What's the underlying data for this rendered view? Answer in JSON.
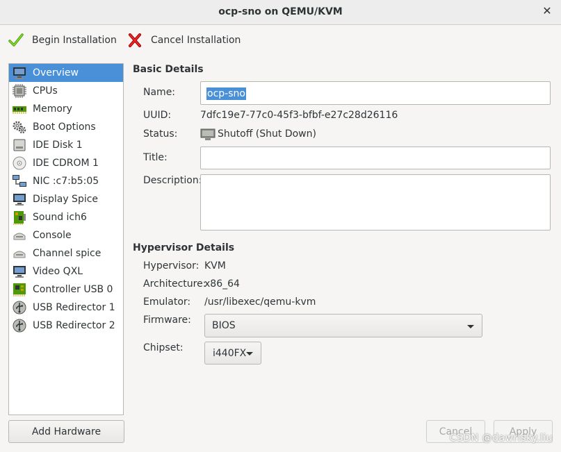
{
  "window": {
    "title": "ocp-sno on QEMU/KVM"
  },
  "toolbar": {
    "begin_label": "Begin Installation",
    "cancel_label": "Cancel Installation"
  },
  "sidebar": {
    "items": [
      {
        "label": "Overview",
        "icon": "monitor-icon",
        "selected": true
      },
      {
        "label": "CPUs",
        "icon": "cpu-icon"
      },
      {
        "label": "Memory",
        "icon": "memory-icon"
      },
      {
        "label": "Boot Options",
        "icon": "gears-icon"
      },
      {
        "label": "IDE Disk 1",
        "icon": "disk-icon"
      },
      {
        "label": "IDE CDROM 1",
        "icon": "cdrom-icon"
      },
      {
        "label": "NIC :c7:b5:05",
        "icon": "network-icon"
      },
      {
        "label": "Display Spice",
        "icon": "display-icon"
      },
      {
        "label": "Sound ich6",
        "icon": "sound-icon"
      },
      {
        "label": "Console",
        "icon": "console-icon"
      },
      {
        "label": "Channel spice",
        "icon": "channel-icon"
      },
      {
        "label": "Video QXL",
        "icon": "video-icon"
      },
      {
        "label": "Controller USB 0",
        "icon": "controller-icon"
      },
      {
        "label": "USB Redirector 1",
        "icon": "usb-icon"
      },
      {
        "label": "USB Redirector 2",
        "icon": "usb-icon"
      }
    ],
    "add_hardware_label": "Add Hardware"
  },
  "basic": {
    "section_title": "Basic Details",
    "name_label": "Name:",
    "name_value": "ocp-sno",
    "uuid_label": "UUID:",
    "uuid_value": "7dfc19e7-77c0-45f3-bfbf-e27c28d26116",
    "status_label": "Status:",
    "status_value": "Shutoff (Shut Down)",
    "title_label": "Title:",
    "title_value": "",
    "description_label": "Description:",
    "description_value": ""
  },
  "hypervisor": {
    "section_title": "Hypervisor Details",
    "hypervisor_label": "Hypervisor:",
    "hypervisor_value": "KVM",
    "architecture_label": "Architecture:",
    "architecture_value": "x86_64",
    "emulator_label": "Emulator:",
    "emulator_value": "/usr/libexec/qemu-kvm",
    "firmware_label": "Firmware:",
    "firmware_value": "BIOS",
    "chipset_label": "Chipset:",
    "chipset_value": "i440FX"
  },
  "footer": {
    "cancel_label": "Cancel",
    "apply_label": "Apply"
  },
  "watermark": "CSDN @dawrisky.liu",
  "colors": {
    "selection": "#4a90d9",
    "background": "#f6f5f4",
    "check_green": "#4e9a06",
    "cancel_red": "#cc0000"
  }
}
